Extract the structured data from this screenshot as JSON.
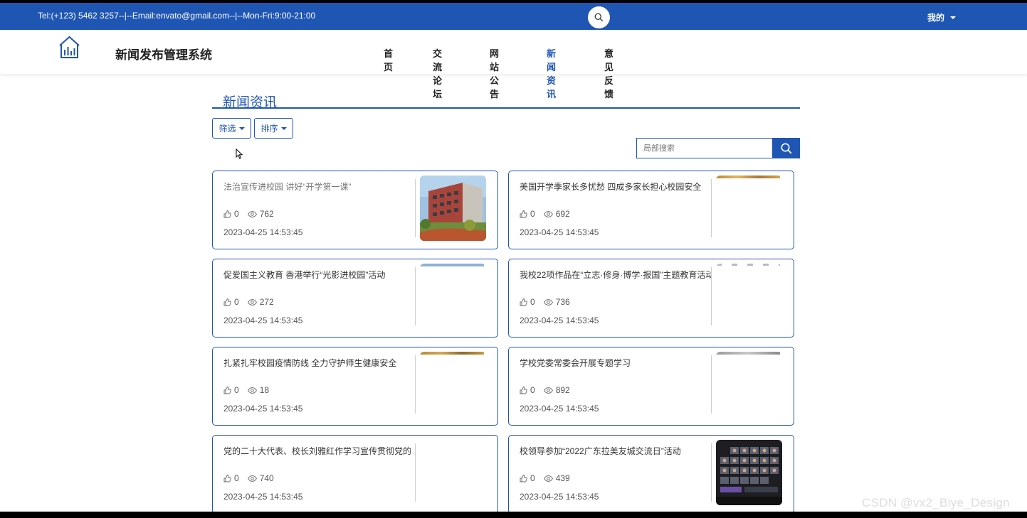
{
  "topbar": {
    "contact": "Tel:(+123) 5462 3257--|--Email:envato@gmail.com--|--Mon-Fri:9:00-21:00",
    "me_label": "我的"
  },
  "header": {
    "site_title": "新闻发布管理系统",
    "nav": [
      {
        "label": "首页"
      },
      {
        "label": "交流论坛"
      },
      {
        "label": "网站公告"
      },
      {
        "label": "新闻资讯",
        "active": true
      },
      {
        "label": "意见反馈"
      }
    ]
  },
  "section": {
    "title": "新闻资讯",
    "filter_label": "筛选",
    "sort_label": "排序",
    "search_placeholder": "局部搜索"
  },
  "news": [
    {
      "title": "法治宣传进校园 讲好“开学第一课”",
      "likes": "0",
      "views": "762",
      "date": "2023-04-25 14:53:45",
      "thumb": "campus-building"
    },
    {
      "title": "美国开学季家长多忧愁 四成多家长担心校园安全",
      "likes": "0",
      "views": "692",
      "date": "2023-04-25 14:53:45",
      "thumb": "partial-top"
    },
    {
      "title": "促爱国主义教育 香港举行“光影进校园”活动",
      "likes": "0",
      "views": "272",
      "date": "2023-04-25 14:53:45",
      "thumb": "partial-top"
    },
    {
      "title": "我校22项作品在“立志·修身·博学·报国”主题教育活动",
      "likes": "0",
      "views": "736",
      "date": "2023-04-25 14:53:45",
      "thumb": "partial-top"
    },
    {
      "title": "扎紧扎牢校园疫情防线 全力守护师生健康安全",
      "likes": "0",
      "views": "18",
      "date": "2023-04-25 14:53:45",
      "thumb": "partial-top"
    },
    {
      "title": "学校党委常委会开展专题学习",
      "likes": "0",
      "views": "892",
      "date": "2023-04-25 14:53:45",
      "thumb": "partial-top"
    },
    {
      "title": "党的二十大代表、校长刘雅红作学习宣传贯彻党的",
      "likes": "0",
      "views": "740",
      "date": "2023-04-25 14:53:45",
      "thumb": "none"
    },
    {
      "title": "校领导参加“2022广东拉美友城交流日”活动",
      "likes": "0",
      "views": "439",
      "date": "2023-04-25 14:53:45",
      "thumb": "video-meeting"
    }
  ],
  "watermark": "CSDN @vx2_Biye_Design",
  "colors": {
    "primary": "#1f56b3"
  }
}
